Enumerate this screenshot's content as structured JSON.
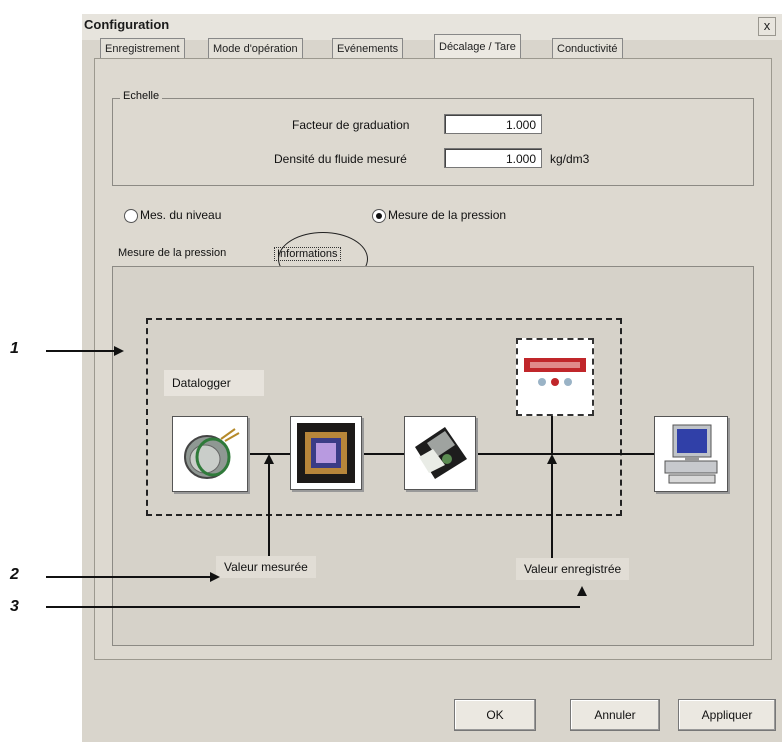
{
  "window": {
    "title": "Configuration",
    "close_glyph": "x"
  },
  "tabs": [
    {
      "label": "Enregistrement"
    },
    {
      "label": "Mode d'opération"
    },
    {
      "label": "Evénements"
    },
    {
      "label": "Décalage / Tare"
    },
    {
      "label": "Conductivité"
    }
  ],
  "active_tab": "Décalage / Tare",
  "scale_group": {
    "label": "Echelle",
    "factor_label": "Facteur de graduation",
    "factor_value": "1.000",
    "density_label": "Densité du fluide mesuré",
    "density_value": "1.000",
    "density_unit": "kg/dm3"
  },
  "mode": {
    "options": [
      {
        "label": "Mes. du niveau",
        "selected": false
      },
      {
        "label": "Mesure de la pression",
        "selected": true
      }
    ]
  },
  "subtabs": [
    {
      "label": "Mesure de la pression"
    },
    {
      "label": "Informations"
    }
  ],
  "diagram": {
    "datalogger_label": "Datalogger",
    "icons": [
      "pressure-sensor-icon",
      "chip-icon",
      "floppy-disk-icon",
      "display-unit-icon",
      "computer-icon"
    ],
    "measured_label": "Valeur mesurée",
    "recorded_label": "Valeur enregistrée"
  },
  "callouts": [
    "1",
    "2",
    "3"
  ],
  "buttons": {
    "ok": "OK",
    "cancel": "Annuler",
    "apply": "Appliquer"
  }
}
